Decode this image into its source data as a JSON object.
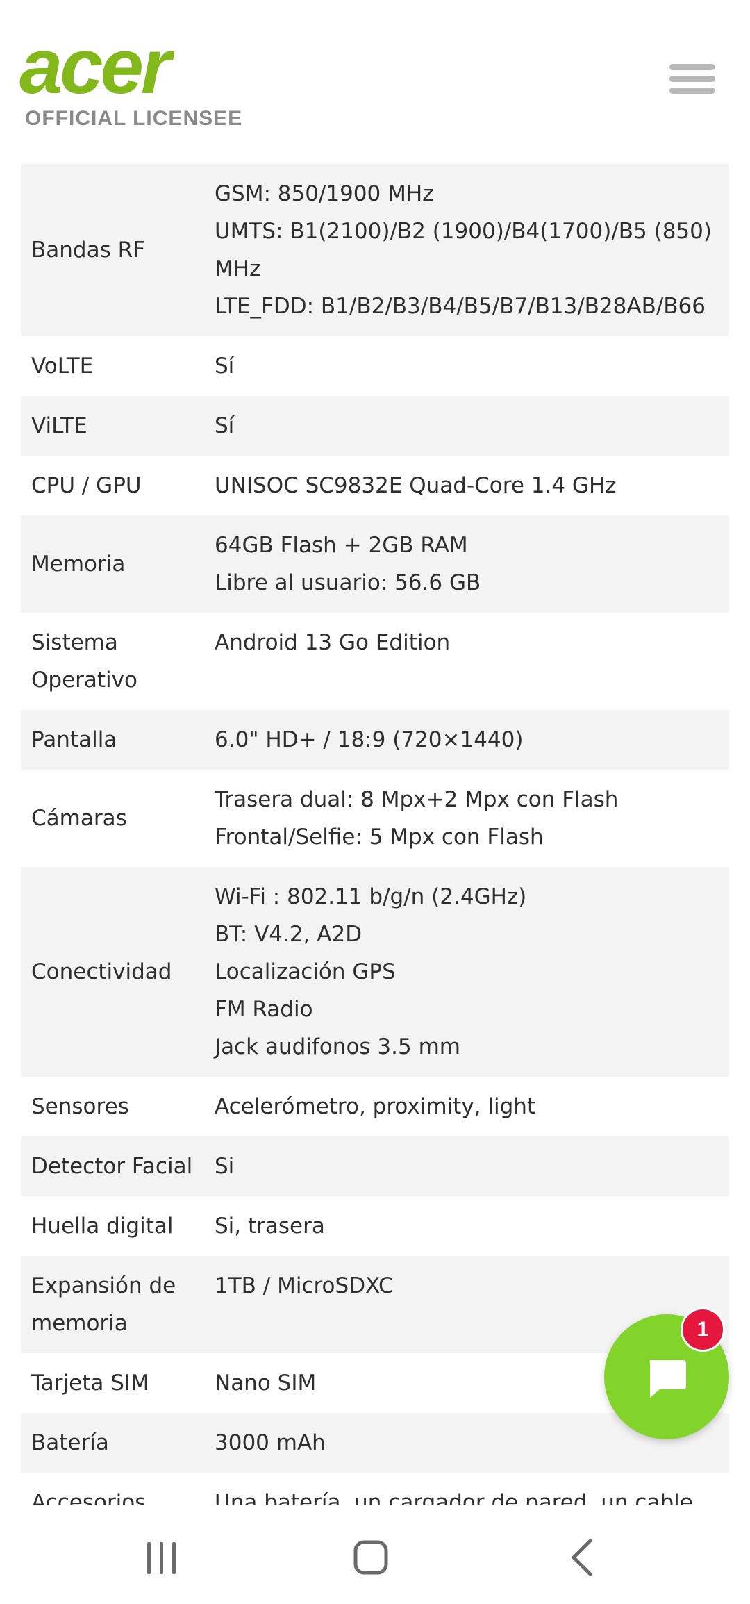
{
  "header": {
    "logo_text": "acer",
    "logo_subtitle": "OFFICIAL LICENSEE",
    "menu_icon": "hamburger-menu-icon"
  },
  "specs": [
    {
      "label": "Bandas RF",
      "lines": [
        "GSM: 850/1900 MHz",
        "UMTS: B1(2100)/B2 (1900)/B4(1700)/B5 (850)",
        "MHz",
        "LTE_FDD: B1/B2/B3/B4/B5/B7/B13/B28AB/B66"
      ]
    },
    {
      "label": "VoLTE",
      "lines": [
        "Sí"
      ]
    },
    {
      "label": "ViLTE",
      "lines": [
        "Sí"
      ]
    },
    {
      "label": "CPU / GPU",
      "lines": [
        "UNISOC SC9832E Quad-Core 1.4 GHz"
      ]
    },
    {
      "label": "Memoria",
      "lines": [
        "64GB Flash + 2GB RAM",
        "Libre al usuario: 56.6 GB"
      ]
    },
    {
      "label": "Sistema Operativo",
      "lines": [
        "Android 13 Go Edition"
      ]
    },
    {
      "label": "Pantalla",
      "lines": [
        "6.0\" HD+ / 18:9 (720×1440)"
      ]
    },
    {
      "label": "Cámaras",
      "lines": [
        "Trasera dual: 8 Mpx+2 Mpx con Flash",
        "Frontal/Selfie: 5 Mpx con Flash"
      ]
    },
    {
      "label": "Conectividad",
      "lines": [
        "Wi-Fi : 802.11 b/g/n (2.4GHz)",
        "BT: V4.2, A2D",
        "Localización GPS",
        "FM Radio",
        "Jack audifonos 3.5 mm"
      ]
    },
    {
      "label": "Sensores",
      "lines": [
        "Acelerómetro, proximity, light"
      ]
    },
    {
      "label": "Detector Facial",
      "lines": [
        "Si"
      ]
    },
    {
      "label": "Huella digital",
      "lines": [
        "Si, trasera"
      ]
    },
    {
      "label": "Expansión de memoria",
      "lines": [
        "1TB / MicroSDXC"
      ]
    },
    {
      "label": "Tarjeta SIM",
      "lines": [
        "Nano SIM"
      ]
    },
    {
      "label": "Batería",
      "lines": [
        "3000 mAh"
      ]
    },
    {
      "label": "Accesorios",
      "lines": [
        "Una batería, un cargador de pared, un cable"
      ]
    }
  ],
  "chat": {
    "badge_count": "1",
    "icon": "chat-bubble-icon",
    "color": "#83d42a",
    "badge_color": "#e5173f"
  },
  "navbar": {
    "recents_icon": "recent-apps-icon",
    "home_icon": "home-icon",
    "back_icon": "back-icon"
  },
  "colors": {
    "brand_green": "#83b81a",
    "row_alt": "#f3f3f3"
  }
}
